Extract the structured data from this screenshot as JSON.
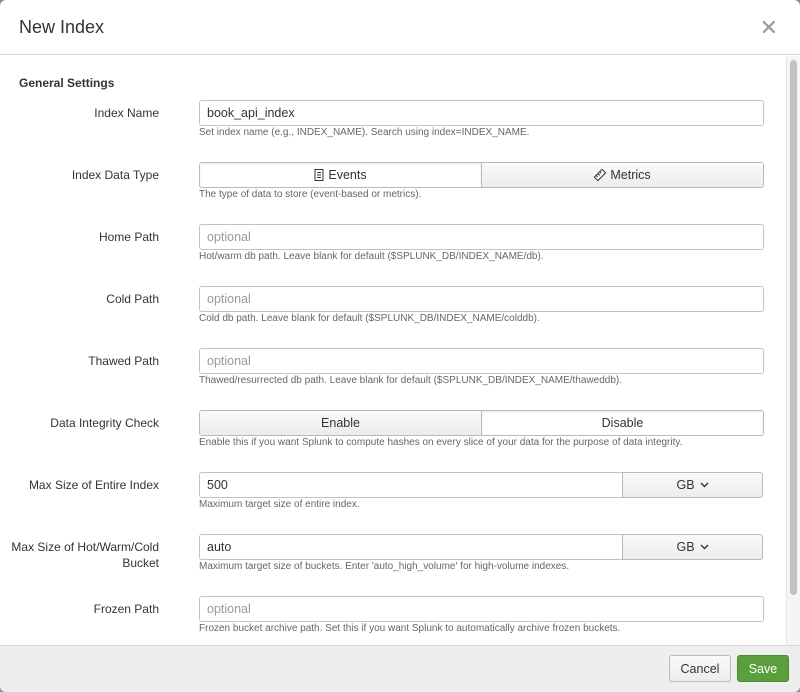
{
  "dialog": {
    "title": "New Index"
  },
  "general": {
    "section_title": "General Settings"
  },
  "fields": {
    "index_name": {
      "label": "Index Name",
      "value": "book_api_index",
      "help": "Set index name (e.g., INDEX_NAME). Search using index=INDEX_NAME."
    },
    "data_type": {
      "label": "Index Data Type",
      "options": [
        "Events",
        "Metrics"
      ],
      "selected": "Events",
      "help": "The type of data to store (event-based or metrics)."
    },
    "home_path": {
      "label": "Home Path",
      "placeholder": "optional",
      "help": "Hot/warm db path. Leave blank for default ($SPLUNK_DB/INDEX_NAME/db)."
    },
    "cold_path": {
      "label": "Cold Path",
      "placeholder": "optional",
      "help": "Cold db path. Leave blank for default ($SPLUNK_DB/INDEX_NAME/colddb)."
    },
    "thawed_path": {
      "label": "Thawed Path",
      "placeholder": "optional",
      "help": "Thawed/resurrected db path. Leave blank for default ($SPLUNK_DB/INDEX_NAME/thaweddb)."
    },
    "integrity": {
      "label": "Data Integrity Check",
      "options": [
        "Enable",
        "Disable"
      ],
      "selected": "Disable",
      "help": "Enable this if you want Splunk to compute hashes on every slice of your data for the purpose of data integrity."
    },
    "max_size": {
      "label": "Max Size of Entire Index",
      "value": "500",
      "unit": "GB",
      "help": "Maximum target size of entire index."
    },
    "max_bucket": {
      "label_line1": "Max Size of Hot/Warm/Cold",
      "label_line2": "Bucket",
      "value": "auto",
      "unit": "GB",
      "help": "Maximum target size of buckets. Enter 'auto_high_volume' for high-volume indexes."
    },
    "frozen_path": {
      "label": "Frozen Path",
      "placeholder": "optional",
      "help": "Frozen bucket archive path. Set this if you want Splunk to automatically archive frozen buckets."
    }
  },
  "footer": {
    "cancel": "Cancel",
    "save": "Save"
  }
}
